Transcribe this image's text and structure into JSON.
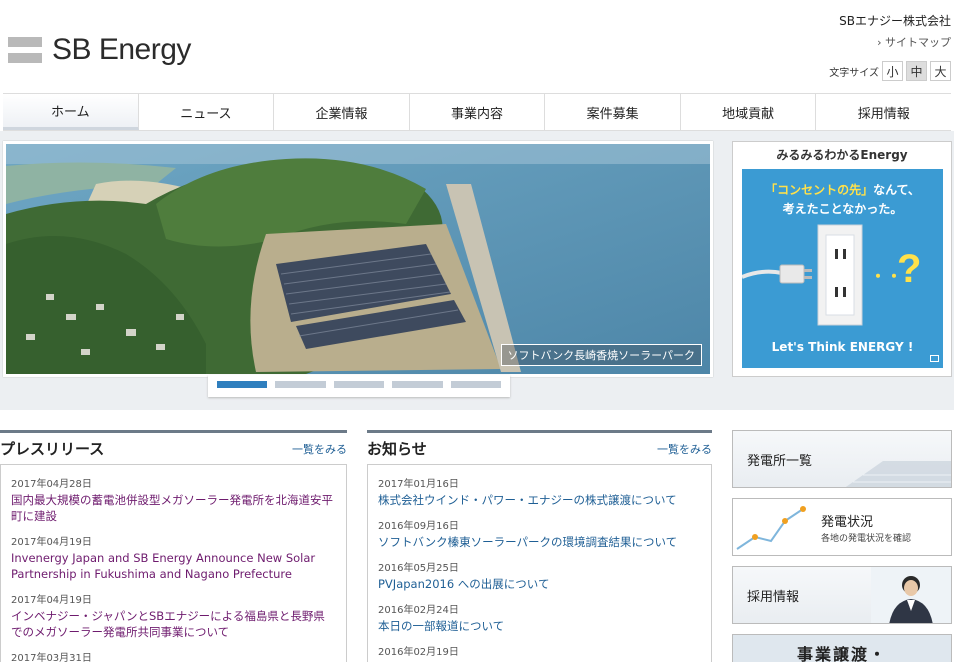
{
  "header": {
    "logo_text": "SB Energy",
    "company_name": "SBエナジー株式会社",
    "sitemap_label": "サイトマップ",
    "font_size_label": "文字サイズ",
    "font_sizes": [
      "小",
      "中",
      "大"
    ],
    "font_size_selected": "中"
  },
  "nav": {
    "items": [
      "ホーム",
      "ニュース",
      "企業情報",
      "事業内容",
      "案件募集",
      "地域貢献",
      "採用情報"
    ],
    "active": "ホーム"
  },
  "hero": {
    "caption": "ソフトバンク長崎香焼ソーラーパーク",
    "slide_count": 5,
    "active_slide": 1
  },
  "promo": {
    "title": "みるみるわかるEnergy",
    "line1_highlight": "「コンセントの先」",
    "line1_rest": "なんて、",
    "line2": "考えたことなかった。",
    "dots": "・・",
    "question": "?",
    "footer": "Let's Think ENERGY !"
  },
  "press": {
    "title": "プレスリリース",
    "more": "一覧をみる",
    "items": [
      {
        "date": "2017年04月28日",
        "title": "国内最大規模の蓄電池併設型メガソーラー発電所を北海道安平町に建設"
      },
      {
        "date": "2017年04月19日",
        "title": "Invenergy Japan and SB Energy Announce New Solar Partnership in Fukushima and Nagano Prefecture"
      },
      {
        "date": "2017年04月19日",
        "title": "インベナジー・ジャパンとSBエナジーによる福島県と長野県でのメガソーラー発電所共同事業について"
      },
      {
        "date": "2017年03月31日",
        "title": ""
      }
    ]
  },
  "news": {
    "title": "お知らせ",
    "more": "一覧をみる",
    "items": [
      {
        "date": "2017年01月16日",
        "title": "株式会社ウインド・パワー・エナジーの株式譲渡について"
      },
      {
        "date": "2016年09月16日",
        "title": "ソフトバンク榛東ソーラーパークの環境調査結果について"
      },
      {
        "date": "2016年05月25日",
        "title": "PVJapan2016 への出展について"
      },
      {
        "date": "2016年02月24日",
        "title": "本日の一部報道について"
      },
      {
        "date": "2016年02月19日",
        "title": ""
      }
    ]
  },
  "banners": {
    "plants": "発電所一覧",
    "status_title": "発電状況",
    "status_sub": "各地の発電状況を確認",
    "recruit": "採用情報",
    "transfer": "事業譲渡・"
  },
  "colors": {
    "accent_blue": "#2f7fbe",
    "press_link": "#6e1b6e",
    "news_link": "#1f5f95",
    "promo_bg": "#3b9bd3",
    "promo_yellow": "#ffe14a"
  }
}
